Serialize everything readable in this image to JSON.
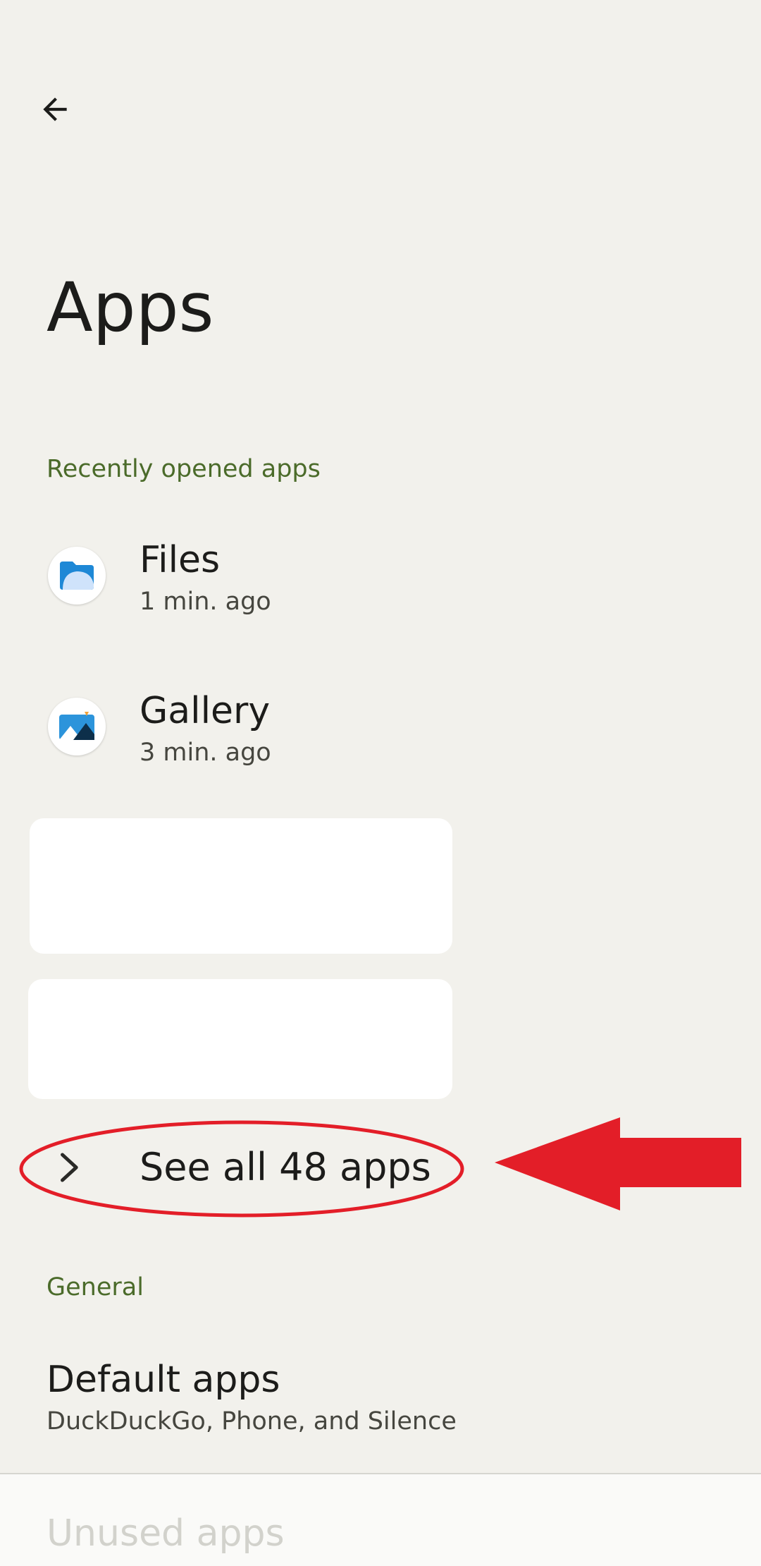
{
  "header": {
    "back_icon": "arrow-left-icon",
    "title": "Apps"
  },
  "recent": {
    "section_label": "Recently opened apps",
    "apps": [
      {
        "name": "Files",
        "time": "1 min. ago",
        "icon": "folder-icon"
      },
      {
        "name": "Gallery",
        "time": "3 min. ago",
        "icon": "gallery-icon"
      }
    ],
    "see_all_label": "See all 48 apps",
    "see_all_icon": "chevron-right-icon"
  },
  "general": {
    "section_label": "General",
    "default_apps": {
      "title": "Default apps",
      "subtitle": "DuckDuckGo, Phone, and Silence"
    },
    "unused_apps": {
      "title": "Unused apps"
    }
  },
  "colors": {
    "background": "#f2f1ec",
    "accent_green": "#4b6b2a",
    "annotation_red": "#e31e28"
  }
}
